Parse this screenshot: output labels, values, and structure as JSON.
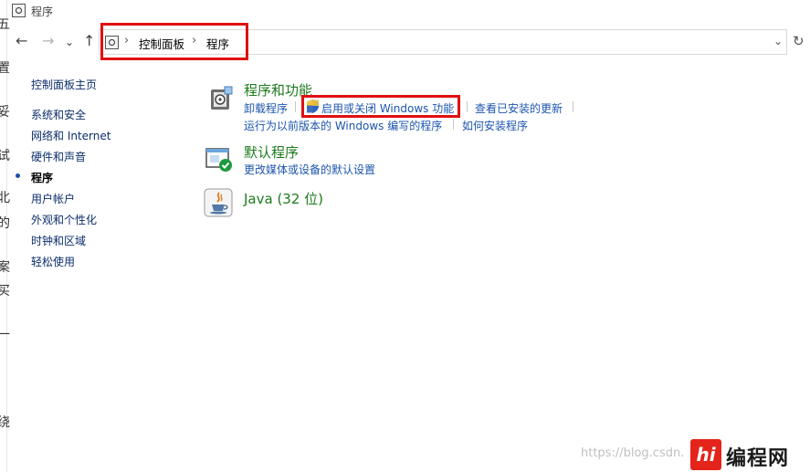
{
  "window": {
    "title": "程序"
  },
  "nav": {
    "back": "←",
    "forward": "→",
    "recent": "⌄",
    "up": "↑",
    "refresh": "↻",
    "address_dropdown": "⌄",
    "breadcrumbs": [
      "控制面板",
      "程序"
    ]
  },
  "left_edge_chars": [
    "五",
    "置",
    "妥",
    "试",
    "北",
    "的",
    "案",
    "买",
    "一",
    "绕"
  ],
  "sidebar": {
    "home": "控制面板主页",
    "items": [
      {
        "label": "系统和安全",
        "current": false
      },
      {
        "label": "网络和 Internet",
        "current": false
      },
      {
        "label": "硬件和声音",
        "current": false
      },
      {
        "label": "程序",
        "current": true
      },
      {
        "label": "用户帐户",
        "current": false
      },
      {
        "label": "外观和个性化",
        "current": false
      },
      {
        "label": "时钟和区域",
        "current": false
      },
      {
        "label": "轻松使用",
        "current": false
      }
    ]
  },
  "sections": {
    "programs": {
      "title": "程序和功能",
      "uninstall": "卸载程序",
      "windows_features": "启用或关闭 Windows 功能",
      "installed_updates": "查看已安装的更新",
      "compat": "运行为以前版本的 Windows 编写的程序",
      "how_install": "如何安装程序"
    },
    "defaults": {
      "title": "默认程序",
      "change_defaults": "更改媒体或设备的默认设置"
    },
    "java": {
      "title": "Java (32 位)"
    }
  },
  "watermark": {
    "url": "https://blog.csdn.",
    "logo": "hi",
    "text": "编程网"
  },
  "colors": {
    "highlight_box": "#e01010",
    "heading": "#1e7a1e",
    "link": "#1c55ae"
  }
}
